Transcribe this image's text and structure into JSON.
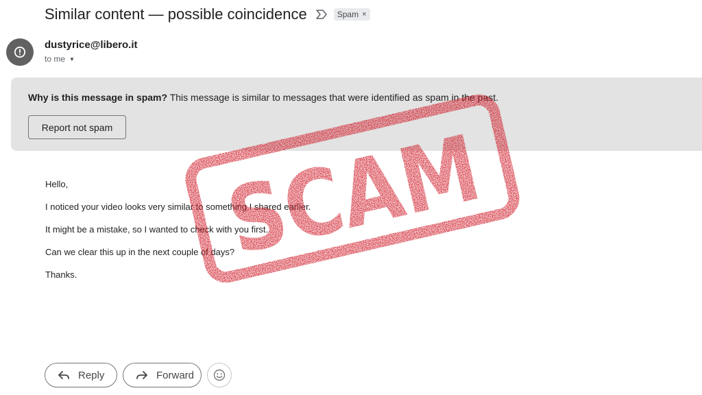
{
  "email": {
    "subject": "Similar content — possible coincidence",
    "label": "Spam",
    "label_remove_glyph": "×",
    "sender": "dustyrice@libero.it",
    "recipient": "to me",
    "sender_avatar_icon": "alert-circle-icon",
    "body": [
      "Hello,",
      "I noticed your video looks very similar to something I shared earlier.",
      "It might be a mistake, so I wanted to check with you first.",
      "Can we clear this up in the next couple of days?",
      "Thanks."
    ]
  },
  "spam_banner": {
    "question": "Why is this message in spam?",
    "explanation": "This message is similar to messages that were identified as spam in the past.",
    "button_label": "Report not spam"
  },
  "actions": {
    "reply_label": "Reply",
    "forward_label": "Forward",
    "emoji_icon": "smiley-icon"
  },
  "overlay": {
    "stamp_text": "SCAM",
    "stamp_color": "#d01f2b"
  }
}
